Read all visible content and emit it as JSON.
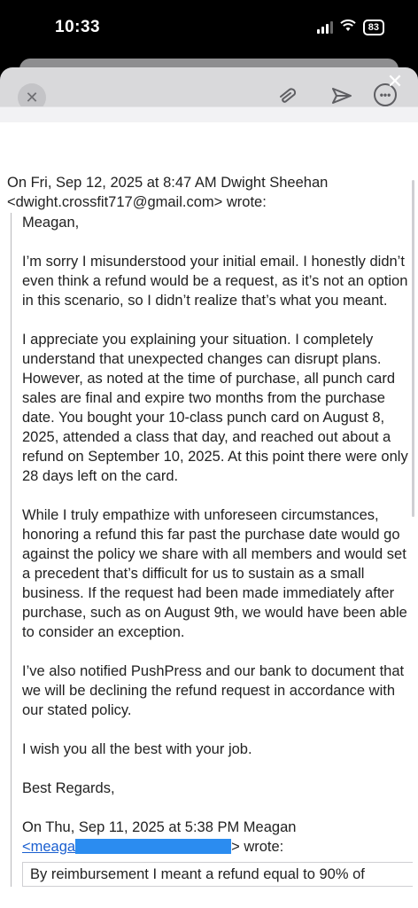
{
  "status_bar": {
    "time": "10:33",
    "battery": "83"
  },
  "toolbar": {
    "close_symbol": "✕",
    "dismiss_symbol": "✕",
    "more_symbol": "•••"
  },
  "email": {
    "quote_header_line1": "On Fri, Sep 12, 2025 at 8:47 AM Dwight Sheehan",
    "quote_header_line2": "<dwight.crossfit717@gmail.com> wrote:",
    "greeting": "Meagan,",
    "paragraphs": [
      "I’m sorry I misunderstood your initial email. I honestly didn’t even think a refund would be a request, as it’s not an option in this scenario, so I didn’t realize that’s what you meant.",
      "I appreciate you explaining your situation. I completely understand that unexpected changes can disrupt plans. However, as noted at the time of purchase, all punch card sales are final and expire two months from the purchase date. You bought your 10-class punch card on August 8, 2025, attended a class that day, and reached out about a refund on September 10, 2025. At this point there were only 28 days left on the card.",
      "While I truly empathize with unforeseen circumstances, honoring a refund this far past the purchase date would go against the policy we share with all members and would set a precedent that’s difficult for us to sustain as a small business. If the request had been made immediately after purchase, such as on August 9th, we would have been able to consider an exception.",
      "I’ve also notified PushPress and our bank to document that we will be declining the refund request in accordance with our stated policy.",
      "I wish you all the best with your job."
    ],
    "signoff": "Best Regards,",
    "inner_header_line1": "On Thu, Sep 11, 2025 at 5:38 PM Meagan",
    "inner_header_link_start": "<meaga",
    "inner_header_link_end": "> wrote:",
    "inner_quote_text": "By reimbursement I meant a refund equal to 90% of"
  },
  "colors": {
    "redaction": "#2b8cf0",
    "link": "#1a5fd0"
  }
}
